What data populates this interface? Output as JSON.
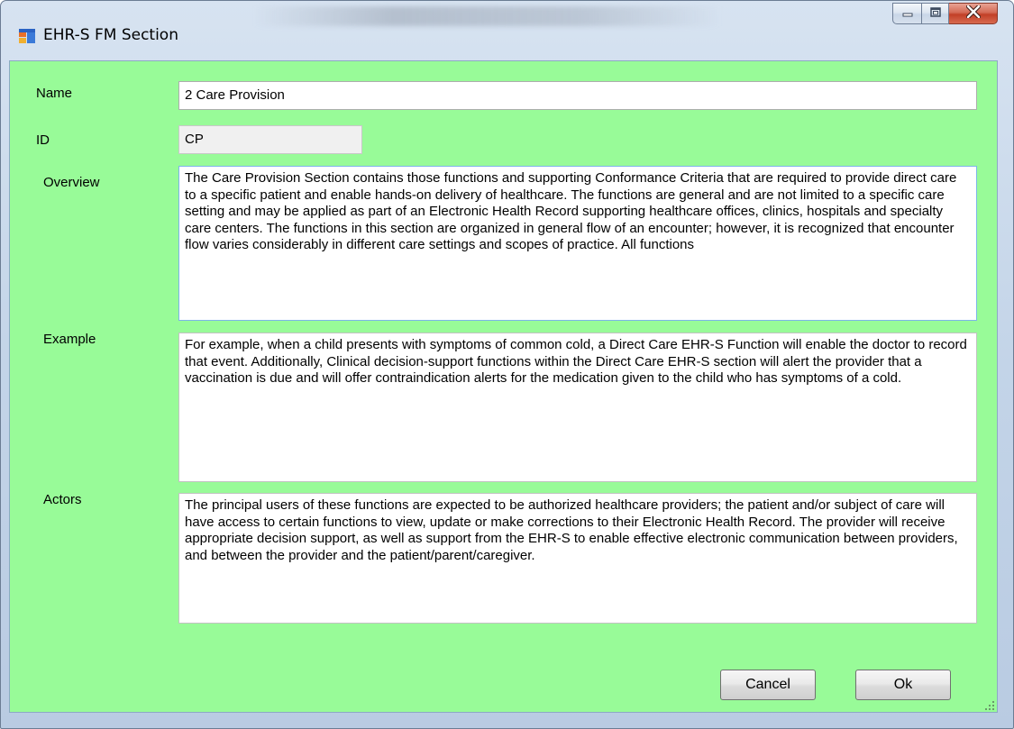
{
  "window": {
    "title": "EHR-S FM Section"
  },
  "icons": {
    "app": "form-window-icon",
    "minimize": "minimize-icon",
    "maximize": "maximize-icon",
    "close": "close-icon"
  },
  "form": {
    "name_label": "Name",
    "name_value": "2 Care Provision",
    "id_label": "ID",
    "id_value": "CP",
    "overview_label": "Overview",
    "overview_value": "The Care Provision Section contains those functions and supporting Conformance Criteria that are required to provide direct care to a specific patient and enable hands-on delivery of healthcare.  The functions are general and are not limited to a specific care setting and may be applied as part of an Electronic Health Record supporting healthcare offices, clinics, hospitals and specialty care centers. The functions in this section are organized in general flow of an encounter; however, it is recognized that encounter flow varies considerably in different care settings and scopes of practice. All functions",
    "example_label": "Example",
    "example_value": "For example, when a child presents with symptoms of common cold, a Direct Care EHR-S Function will enable the doctor to record that event.  Additionally, Clinical decision-support functions within the Direct Care EHR-S section will alert the provider that a vaccination is due and will offer contraindication alerts for the medication given to the child who has symptoms of a cold.",
    "actors_label": "Actors",
    "actors_value": "The principal users of these functions are expected to be authorized healthcare providers; the patient and/or subject of care will have access to certain functions to view, update or make corrections to their Electronic Health Record.  The provider will receive appropriate decision support, as well as support from the EHR-S to enable effective electronic communication between providers, and between the provider and the patient/parent/caregiver."
  },
  "buttons": {
    "cancel": "Cancel",
    "ok": "Ok"
  },
  "colors": {
    "form_background": "#98fb98"
  }
}
